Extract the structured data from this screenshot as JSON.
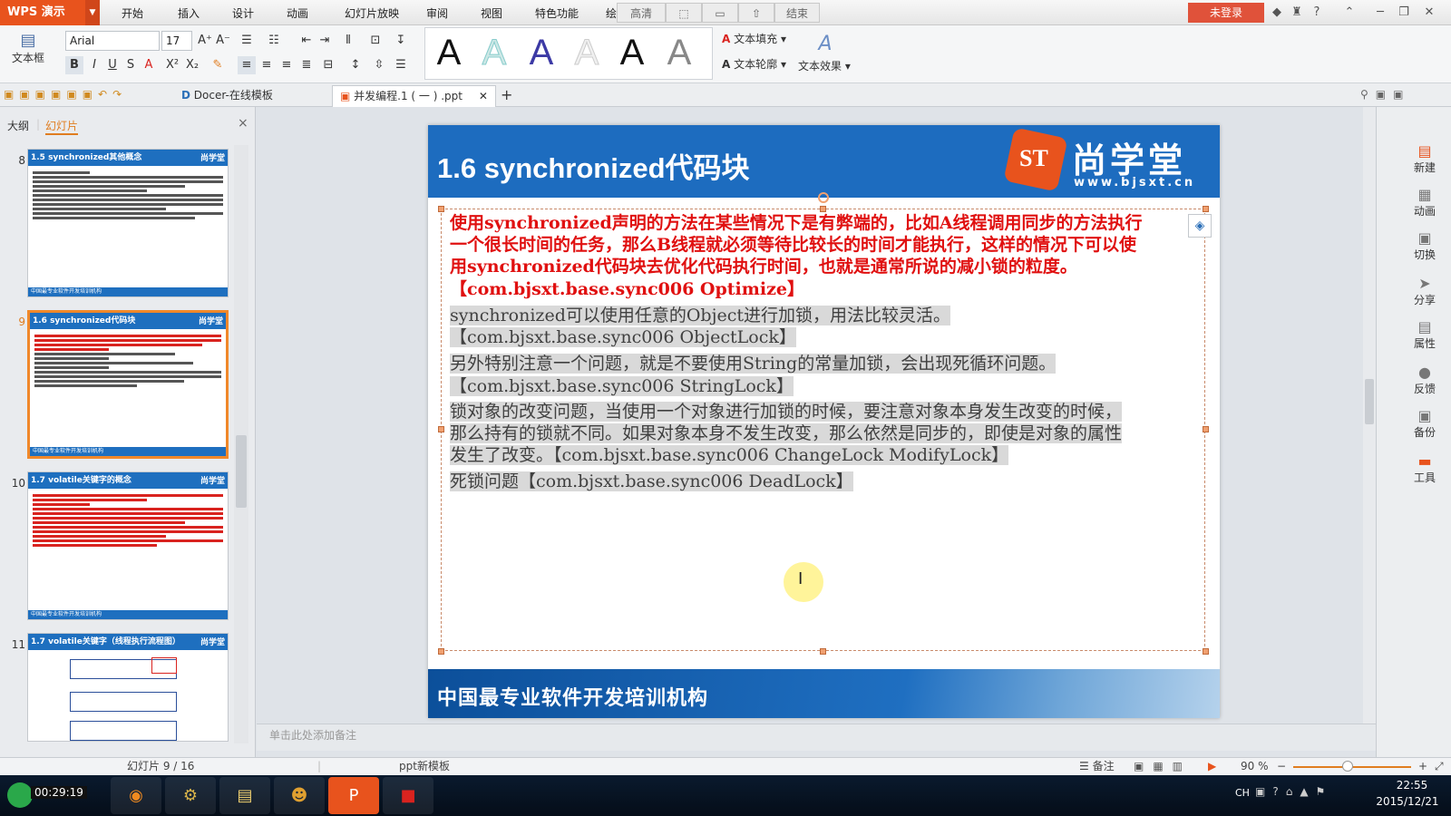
{
  "app": {
    "name": "WPS 演示",
    "login": "未登录"
  },
  "menu": [
    "开始",
    "插入",
    "设计",
    "动画",
    "幻灯片放映",
    "审阅",
    "视图",
    "特色功能",
    "绘"
  ],
  "toolbar_tabs": [
    "高清",
    "结束"
  ],
  "ribbon": {
    "textbox_label": "文本框",
    "font_name": "Arial",
    "font_size": "17",
    "text_fill": "文本填充",
    "text_outline": "文本轮廓",
    "text_effect": "文本效果",
    "style_letters": [
      "A",
      "A",
      "A",
      "A",
      "A",
      "A"
    ]
  },
  "tabs": {
    "docer": "Docer-在线模板",
    "file": "并发编程.1 ( 一 ) .ppt",
    "new_tab": "+"
  },
  "left_panel": {
    "tab_outline": "大纲",
    "tab_slides": "幻灯片",
    "close": "×",
    "thumbs": [
      {
        "num": "8",
        "title": "1.5 synchronized其他概念"
      },
      {
        "num": "9",
        "title": "1.6 synchronized代码块"
      },
      {
        "num": "10",
        "title": "1.7 volatile关键字的概念"
      },
      {
        "num": "11",
        "title": "1.7 volatile关键字（线程执行流程图）"
      }
    ],
    "thumb_logo": "尚学堂",
    "thumb_footer": "中国最专业软件开发培训机构"
  },
  "slide": {
    "title": "1.6 synchronized代码块",
    "logo_main": "尚学堂",
    "logo_url": "www.bjsxt.cn",
    "footer": "中国最专业软件开发培训机构",
    "paragraphs": {
      "p1_l1": "使用synchronized声明的方法在某些情况下是有弊端的，比如A线程调用同步的方法执行",
      "p1_l2": "一个很长时间的任务，那么B线程就必须等待比较长的时间才能执行，这样的情况下可以使",
      "p1_l3": "用synchronized代码块去优化代码执行时间，也就是通常所说的减小锁的粒度。",
      "p1_l4": "【com.bjsxt.base.sync006 Optimize】",
      "p2_l1": "synchronized可以使用任意的Object进行加锁，用法比较灵活。",
      "p2_l2": "【com.bjsxt.base.sync006 ObjectLock】",
      "p3_l1": "另外特别注意一个问题，就是不要使用String的常量加锁，会出现死循环问题。",
      "p3_l2": "【com.bjsxt.base.sync006 StringLock】",
      "p4_l1": "锁对象的改变问题，当使用一个对象进行加锁的时候，要注意对象本身发生改变的时候，",
      "p4_l2": "那么持有的锁就不同。如果对象本身不发生改变，那么依然是同步的，即使是对象的属性",
      "p4_l3": "发生了改变。【com.bjsxt.base.sync006 ChangeLock ModifyLock】",
      "p5_l1": "死锁问题【com.bjsxt.base.sync006 DeadLock】"
    }
  },
  "notes_placeholder": "单击此处添加备注",
  "right_tools": [
    "新建",
    "动画",
    "切换",
    "分享",
    "属性",
    "反馈",
    "备份",
    "工具"
  ],
  "status": {
    "slide_count": "幻灯片 9 / 16",
    "template": "ppt新模板",
    "notes": "备注",
    "zoom": "90 %"
  },
  "taskbar": {
    "recorder_time": "00:29:19",
    "lang": "CH",
    "time": "22:55",
    "date": "2015/12/21"
  },
  "colors": {
    "wps_orange": "#e8531d",
    "slide_blue": "#1d6cbf",
    "red_text": "#e01010",
    "selection_orange": "#f0882a"
  }
}
